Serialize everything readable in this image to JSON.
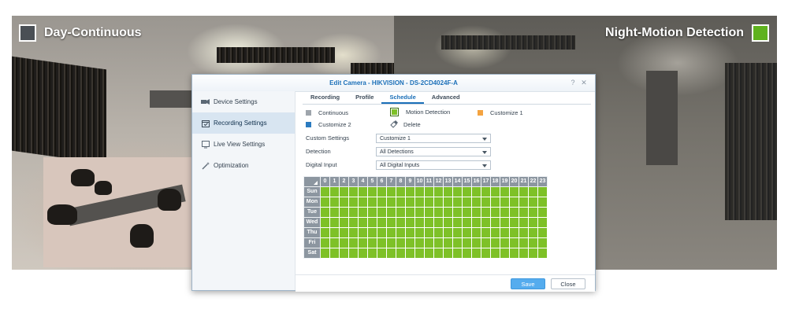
{
  "left_camera": {
    "label": "Day-Continuous",
    "swatch_color": "#4a4f55"
  },
  "right_camera": {
    "label": "Night-Motion Detection",
    "swatch_color": "#5fb21e"
  },
  "dialog": {
    "title": "Edit Camera - HIKVISION - DS-2CD4024F-A",
    "help": "?",
    "close_icon": "✕"
  },
  "sidebar": {
    "items": [
      {
        "label": "Device Settings",
        "icon": "camera-settings-icon"
      },
      {
        "label": "Recording Settings",
        "icon": "calendar-icon"
      },
      {
        "label": "Live View Settings",
        "icon": "monitor-icon"
      },
      {
        "label": "Optimization",
        "icon": "wand-icon"
      }
    ],
    "active_index": 1
  },
  "tabs": {
    "items": [
      "Recording",
      "Profile",
      "Schedule",
      "Advanced"
    ],
    "active_index": 2
  },
  "legend": {
    "continuous": {
      "label": "Continuous",
      "color": "#9ea5ac"
    },
    "motion": {
      "label": "Motion Detection",
      "color": "#7ec127"
    },
    "customize1": {
      "label": "Customize 1",
      "color": "#f4a340"
    },
    "customize2": {
      "label": "Customize 2",
      "color": "#2b7bc0"
    },
    "delete": {
      "label": "Delete",
      "icon": "eraser-icon"
    }
  },
  "form": {
    "custom_settings": {
      "label": "Custom Settings",
      "value": "Customize 1"
    },
    "detection": {
      "label": "Detection",
      "value": "All Detections"
    },
    "digital_input": {
      "label": "Digital Input",
      "value": "All Digital Inputs"
    }
  },
  "schedule": {
    "hours": [
      "0",
      "1",
      "2",
      "3",
      "4",
      "5",
      "6",
      "7",
      "8",
      "9",
      "10",
      "11",
      "12",
      "13",
      "14",
      "15",
      "16",
      "17",
      "18",
      "19",
      "20",
      "21",
      "22",
      "23"
    ],
    "days": [
      "Sun",
      "Mon",
      "Tue",
      "Wed",
      "Thu",
      "Fri",
      "Sat"
    ],
    "fill_mode": "Motion Detection",
    "fill_color": "#7ec127"
  },
  "footer": {
    "save_label": "Save",
    "close_label": "Close"
  }
}
